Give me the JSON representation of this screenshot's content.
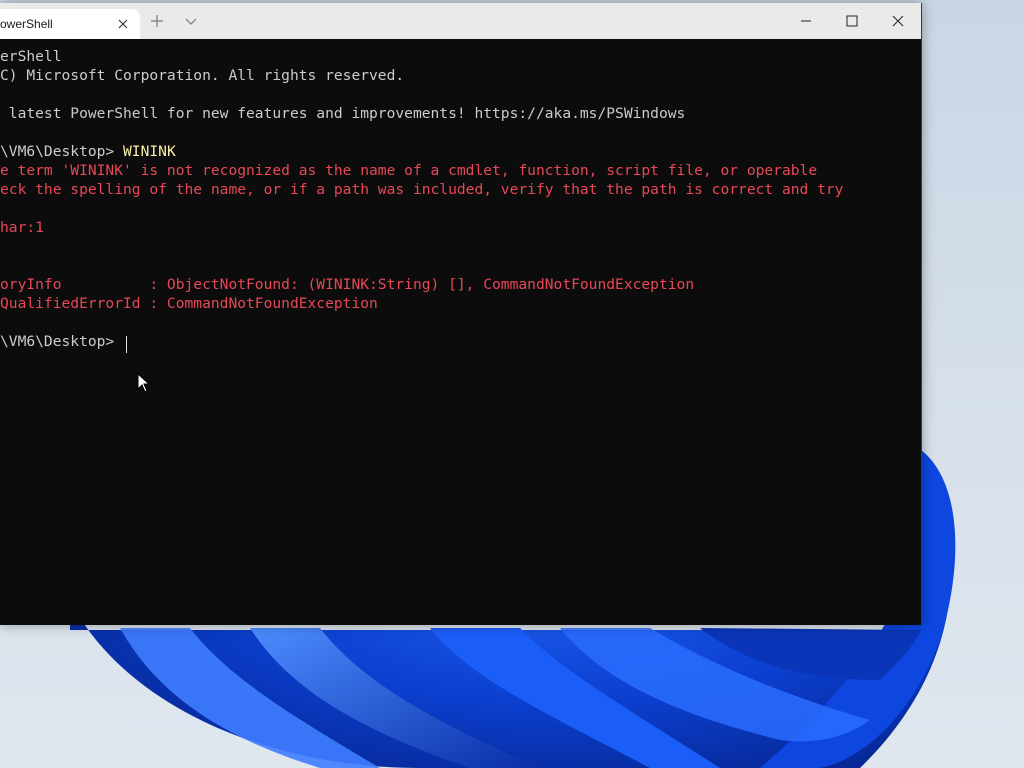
{
  "window": {
    "tab_title": "owerShell",
    "new_tab_label": "+",
    "colors": {
      "background": "#0c0c0c",
      "text": "#cccccc",
      "error": "#e74856",
      "command": "#f9f1a5",
      "titlebar": "#eaeaea"
    },
    "icons": {
      "tab_close": "close-icon",
      "new_tab": "plus-icon",
      "dropdown": "chevron-down-icon",
      "minimize": "minimize-icon",
      "maximize": "maximize-icon",
      "close": "close-icon"
    }
  },
  "console": {
    "lines": [
      "erShell",
      "C) Microsoft Corporation. All rights reserved.",
      "",
      " latest PowerShell for new features and improvements! https://aka.ms/PSWindows",
      "",
      "\\VM6\\Desktop> ",
      "e term 'WININK' is not recognized as the name of a cmdlet, function, script file, or operable",
      "eck the spelling of the name, or if a path was included, verify that the path is correct and try",
      "",
      "har:1",
      "",
      "",
      "oryInfo          : ObjectNotFound: (WININK:String) [], CommandNotFoundException",
      "QualifiedErrorId : CommandNotFoundException",
      "",
      "\\VM6\\Desktop> "
    ],
    "typed_command": "WININK"
  }
}
